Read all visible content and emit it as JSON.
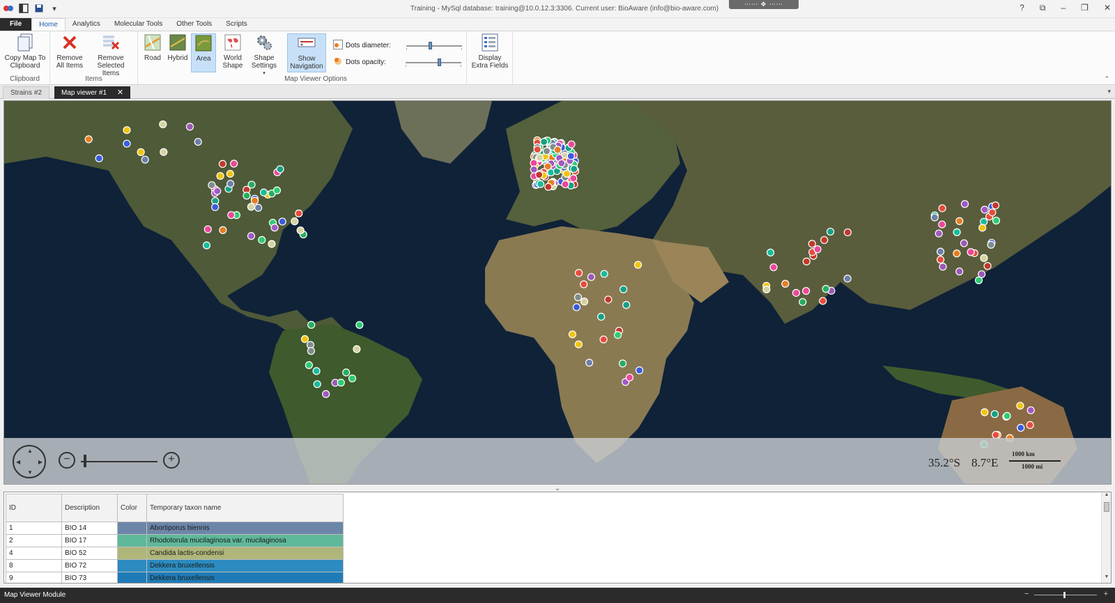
{
  "titlebar": {
    "title": "Training - MySql database: training@10.0.12.3:3306. Current user: BioAware (info@bio-aware.com)",
    "dock_handle": "⋯⋯ ✥ ⋯⋯",
    "help": "?",
    "restore_ribbon": "⧉",
    "minimize": "–",
    "maximize": "❐",
    "close": "✕"
  },
  "ribbon_tabs": [
    "File",
    "Home",
    "Analytics",
    "Molecular Tools",
    "Other Tools",
    "Scripts"
  ],
  "ribbon": {
    "clipboard_group": "Clipboard",
    "copy_map": "Copy Map To Clipboard",
    "items_group": "Items",
    "remove_all": "Remove All Items",
    "remove_selected": "Remove Selected Items",
    "map_viewer_group": "Map Viewer Options",
    "road": "Road",
    "hybrid": "Hybrid",
    "area": "Area",
    "world_shape": "World Shape",
    "shape_settings": "Shape Settings",
    "show_navigation": "Show Navigation",
    "dots_diameter": "Dots diameter:",
    "dots_opacity": "Dots opacity:",
    "dots_diameter_value": 0.42,
    "dots_opacity_value": 0.62,
    "display_extra_fields": "Display Extra Fields"
  },
  "doc_tabs": [
    {
      "label": "Strains #2",
      "active": false
    },
    {
      "label": "Map viewer #1",
      "active": true
    }
  ],
  "doc_tab_close": "✕",
  "map": {
    "latitude": "35.2°S",
    "longitude": "8.7°E",
    "scale_km": "1000 km",
    "scale_mi": "1000 mi",
    "dot_colors": [
      "#2ecc71",
      "#a259c4",
      "#e74c3c",
      "#3b5bdb",
      "#f1c40f",
      "#16a085",
      "#ec4899",
      "#7f8c8d",
      "#e67e22",
      "#1abc9c",
      "#9b59b6",
      "#27ae60",
      "#c0392b",
      "#d4d4a0",
      "#6c7fa8"
    ]
  },
  "grid": {
    "headers": [
      "ID",
      "Description",
      "Color",
      "Temporary taxon name"
    ],
    "rows": [
      {
        "id": "1",
        "description": "BIO 14",
        "color": "#6c86a8",
        "taxon": "Abortiporus biennis"
      },
      {
        "id": "2",
        "description": "BIO 17",
        "color": "#5fb89a",
        "taxon": "Rhodotorula mucilaginosa var. mucilaginosa"
      },
      {
        "id": "4",
        "description": "BIO 52",
        "color": "#b0b67a",
        "taxon": "Candida lactis-condensi"
      },
      {
        "id": "8",
        "description": "BIO 72",
        "color": "#2c8bc0",
        "taxon": "Dekkera bruxellensis"
      },
      {
        "id": "9",
        "description": "BIO 73",
        "color": "#1f7bb8",
        "taxon": "Dekkera bruxellensis"
      }
    ]
  },
  "statusbar": {
    "label": "Map Viewer Module"
  }
}
